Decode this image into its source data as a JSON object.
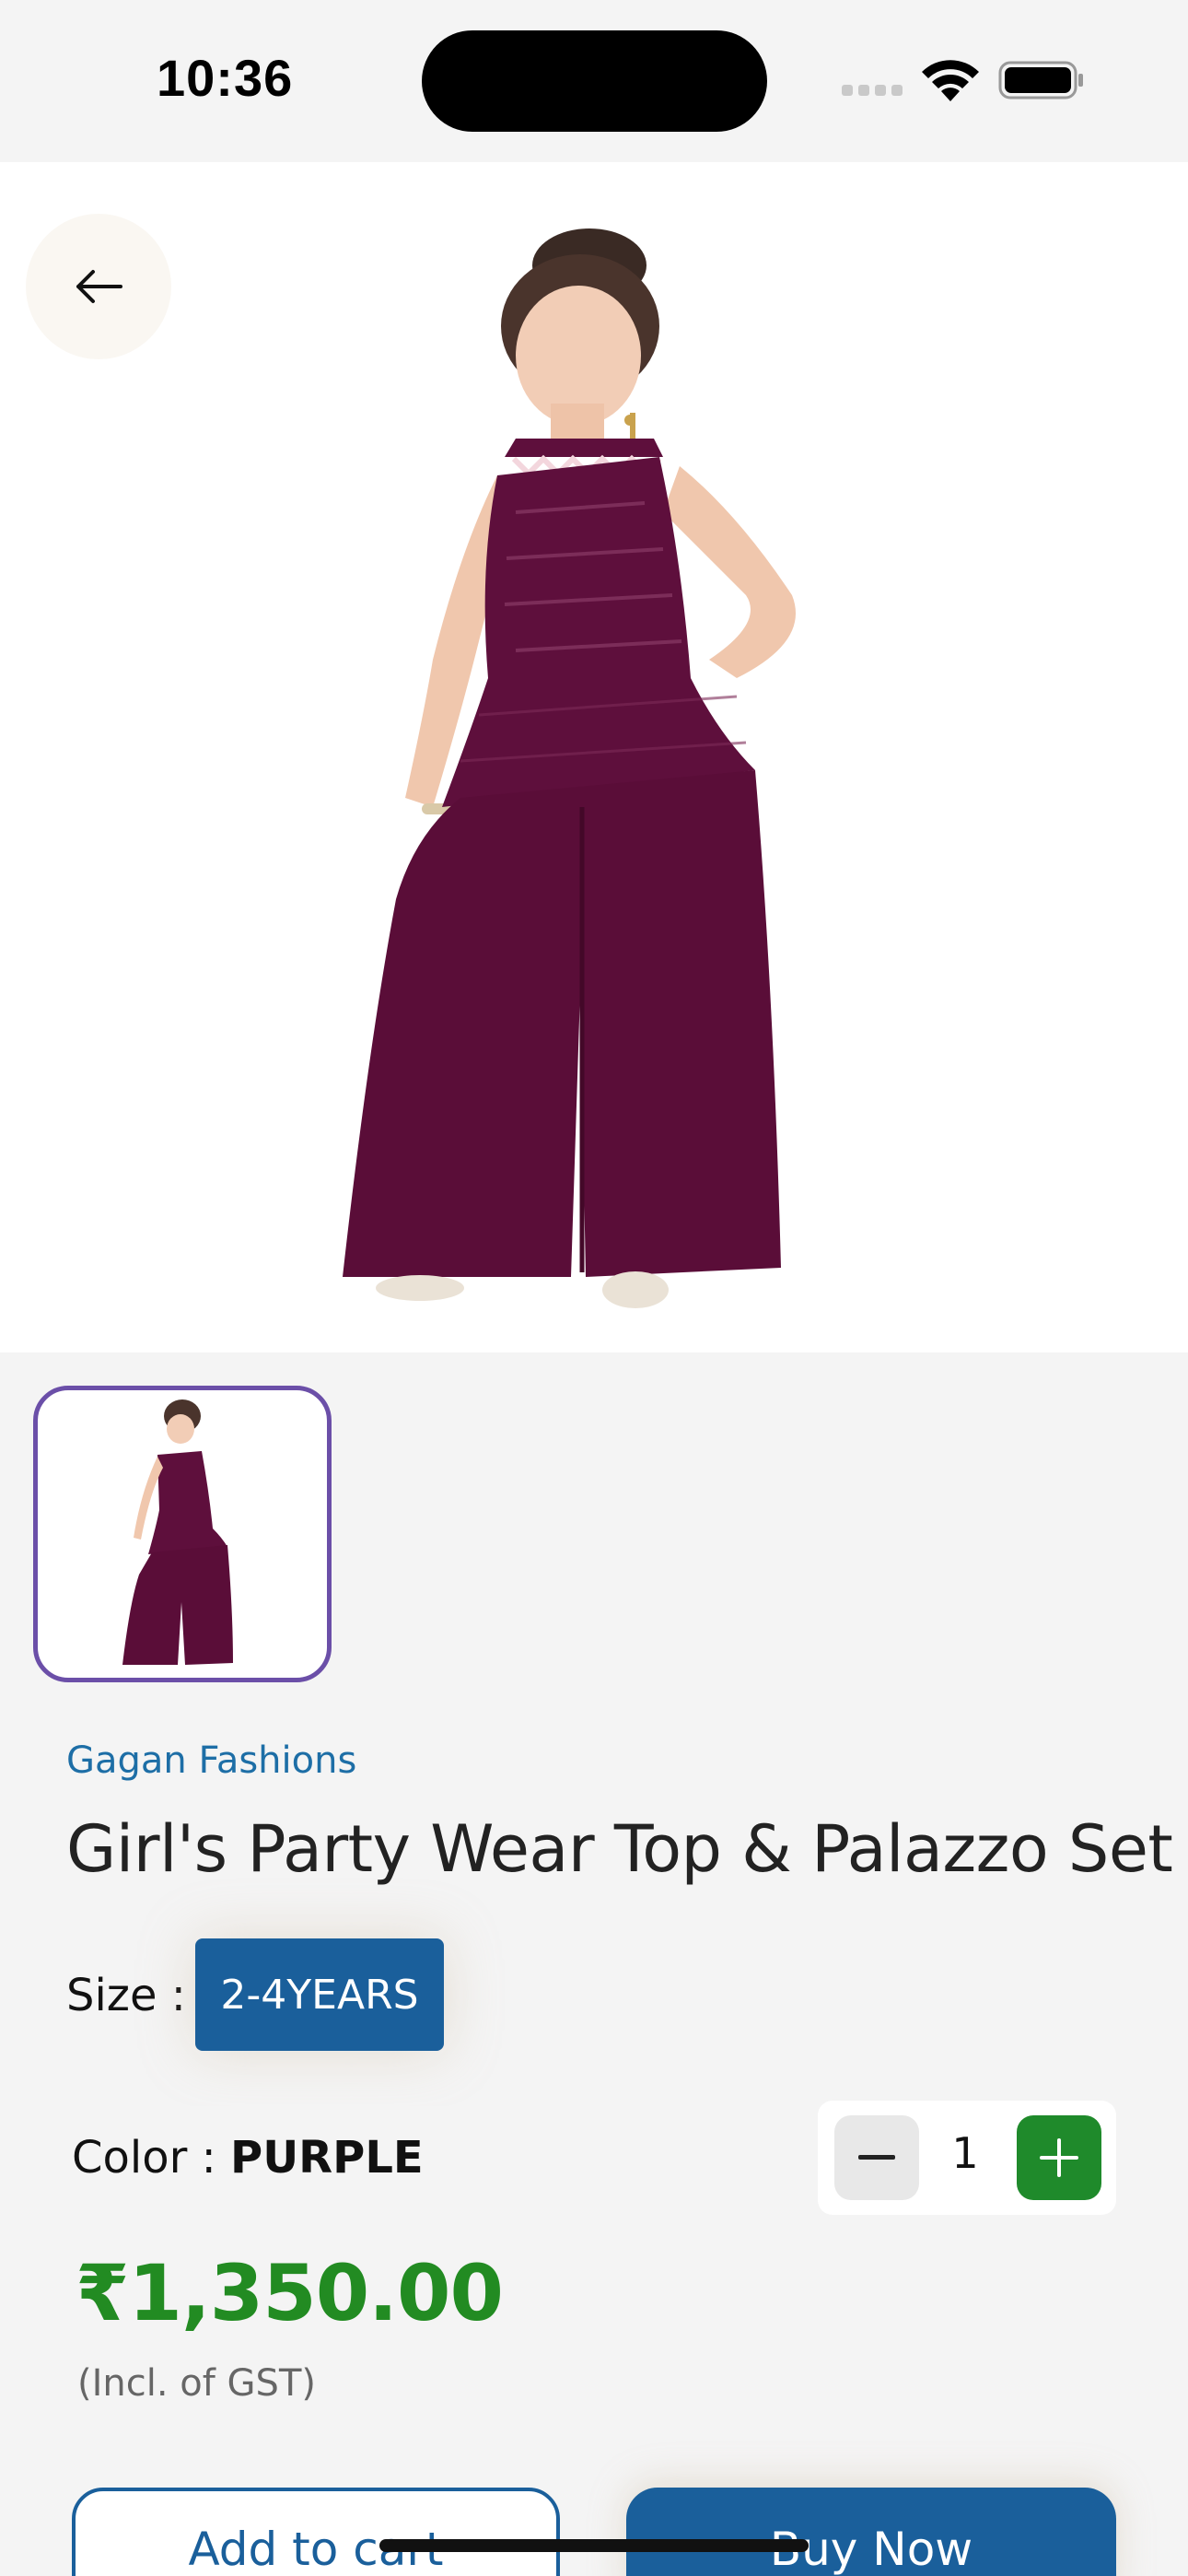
{
  "status_bar": {
    "time": "10:36"
  },
  "product": {
    "brand": "Gagan Fashions",
    "title": "Girl's Party Wear Top & Palazzo Set",
    "size_label": "Size :",
    "size_selected": "2-4YEARS",
    "color_label": "Color :",
    "color_value": "PURPLE",
    "quantity": "1",
    "price": "₹1,350.00",
    "tax_note": "(Incl. of GST)"
  },
  "actions": {
    "add_to_cart": "Add to cart",
    "buy_now": "Buy Now"
  },
  "colors": {
    "accent_blue": "#1a5f9b",
    "price_green": "#228b22",
    "plus_green": "#1f8a2b",
    "garment_purple": "#5e0f3c",
    "thumb_border": "#6b4fa8"
  },
  "icons": [
    "back-arrow-icon",
    "minus-icon",
    "plus-icon",
    "wifi-icon",
    "battery-icon",
    "signal-icon"
  ]
}
